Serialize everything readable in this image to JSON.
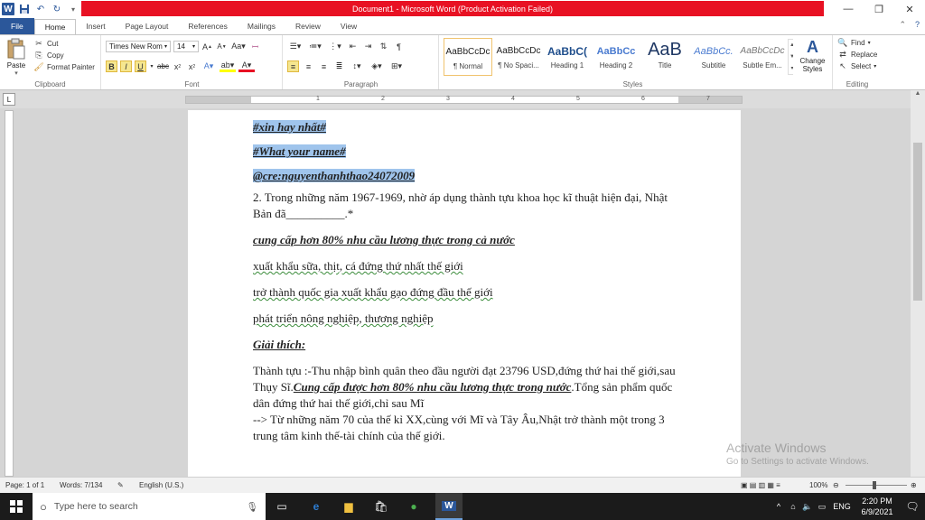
{
  "window": {
    "title": "Document1 - Microsoft Word (Product Activation Failed)",
    "minimize_glyph": "—",
    "restore_glyph": "❐",
    "close_glyph": "✕"
  },
  "tabs": [
    "File",
    "Home",
    "Insert",
    "Page Layout",
    "References",
    "Mailings",
    "Review",
    "View"
  ],
  "clipboard": {
    "paste": "Paste",
    "cut": "Cut",
    "copy": "Copy",
    "format_painter": "Format Painter",
    "label": "Clipboard"
  },
  "font": {
    "name": "Times New Rom",
    "size": "14",
    "label": "Font"
  },
  "paragraph": {
    "label": "Paragraph"
  },
  "styles": {
    "label": "Styles",
    "items": [
      {
        "sample": "AaBbCcDc",
        "name": "¶ Normal"
      },
      {
        "sample": "AaBbCcDc",
        "name": "¶ No Spaci..."
      },
      {
        "sample": "AaBbC(",
        "name": "Heading 1"
      },
      {
        "sample": "AaBbCc",
        "name": "Heading 2"
      },
      {
        "sample": "AaB",
        "name": "Title"
      },
      {
        "sample": "AaBbCc.",
        "name": "Subtitle"
      },
      {
        "sample": "AaBbCcDc",
        "name": "Subtle Em..."
      }
    ],
    "change_styles": "Change Styles"
  },
  "editing": {
    "find": "Find",
    "replace": "Replace",
    "select": "Select",
    "label": "Editing"
  },
  "document": {
    "line1": "#xin hay nhất#",
    "line2": "#What your name#",
    "line3": "@cre:nguyenthanhthao24072009",
    "question": "2. Trong những năm 1967-1969, nhờ áp dụng thành tựu khoa học kĩ thuật hiện đại, Nhật Bản đã__________.*",
    "answer": "cung cấp hơn 80% nhu cầu lương thực trong cả nước",
    "opt1": "xuất khẩu sữa, thịt, cá đứng thứ nhất thế giới",
    "opt2": "trở thành quốc gia xuất khẩu gạo đứng đầu thế giới",
    "opt3": "phát triển nông nghiệp, thương nghiệp",
    "explain_title": "Giải thích:",
    "explain_a": "Thành tựu :-Thu nhập bình quân theo đầu người đạt 23796 USD,đứng thứ hai thế giới,sau Thụy Sĩ.",
    "explain_b": "Cung cấp được hơn 80% nhu cầu lương thực trong nước",
    "explain_c": ".Tổng sản phẩm quốc dân đứng thứ hai thế giới,chỉ sau Mĩ",
    "explain_d": "--> Từ những năm 70 của thế kỉ XX,cùng với Mĩ và Tây Âu,Nhật trở thành một trong 3 trung tâm kinh thế-tài chính của thế giới."
  },
  "watermark": {
    "line1": "Activate Windows",
    "line2": "Go to Settings to activate Windows."
  },
  "status": {
    "page": "Page: 1 of 1",
    "words": "Words: 7/134",
    "language": "English (U.S.)",
    "zoom": "100%"
  },
  "taskbar": {
    "search_placeholder": "Type here to search",
    "lang": "ENG",
    "time": "2:20 PM",
    "date": "6/9/2021"
  },
  "colors": {
    "accent": "#2b579a",
    "title_error": "#e81123",
    "selection": "#9fc4ec"
  }
}
